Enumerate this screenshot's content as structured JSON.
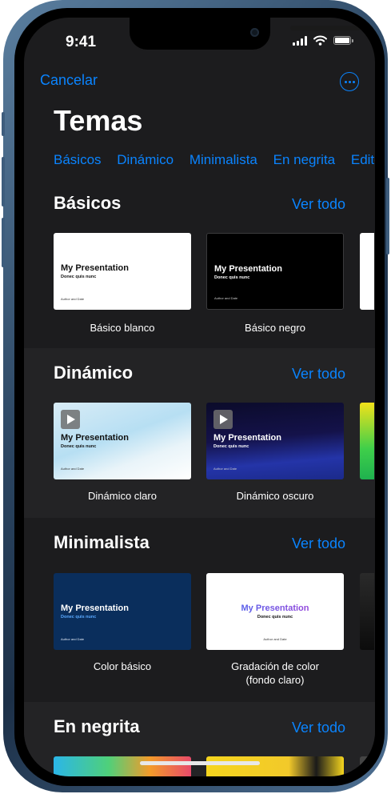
{
  "status": {
    "time": "9:41"
  },
  "nav": {
    "cancel_label": "Cancelar"
  },
  "page": {
    "title": "Temas"
  },
  "tabs": [
    "Básicos",
    "Dinámico",
    "Minimalista",
    "En negrita",
    "Edito"
  ],
  "sections": [
    {
      "title": "Básicos",
      "see_all": "Ver todo",
      "themes": [
        {
          "name": "Básico blanco",
          "slide_title": "My Presentation",
          "slide_subtitle": "Donec quis nunc",
          "slide_author": "Author and Date"
        },
        {
          "name": "Básico negro",
          "slide_title": "My Presentation",
          "slide_subtitle": "Donec quis nunc",
          "slide_author": "Author and Date"
        }
      ]
    },
    {
      "title": "Dinámico",
      "see_all": "Ver todo",
      "themes": [
        {
          "name": "Dinámico claro",
          "slide_title": "My Presentation",
          "slide_subtitle": "Donec quis nunc",
          "slide_author": "Author and Date"
        },
        {
          "name": "Dinámico oscuro",
          "slide_title": "My Presentation",
          "slide_subtitle": "Donec quis nunc",
          "slide_author": "Author and Date"
        }
      ]
    },
    {
      "title": "Minimalista",
      "see_all": "Ver todo",
      "themes": [
        {
          "name": "Color básico",
          "slide_title": "My Presentation",
          "slide_subtitle": "Donec quis nunc",
          "slide_author": "Author and Date"
        },
        {
          "name_line1": "Gradación de color",
          "name_line2": "(fondo claro)",
          "slide_title": "My Presentation",
          "slide_subtitle": "Donec quis nunc",
          "slide_author": "Author and Date"
        }
      ]
    },
    {
      "title": "En negrita",
      "see_all": "Ver todo"
    }
  ],
  "colors": {
    "accent": "#0a84ff",
    "background": "#1c1c1e",
    "section_alt": "#232325"
  },
  "icons": [
    "more-icon",
    "play-icon",
    "signal-icon",
    "wifi-icon",
    "battery-icon"
  ]
}
